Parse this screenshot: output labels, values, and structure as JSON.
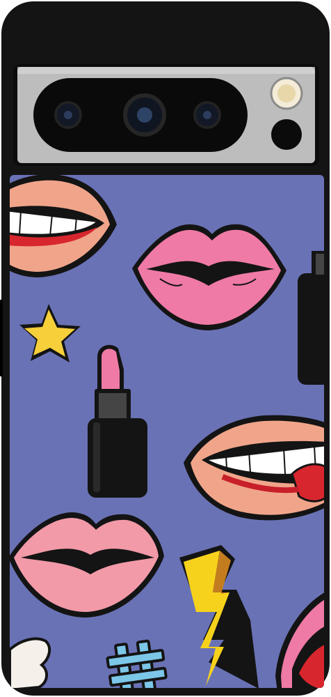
{
  "product": {
    "kind": "phone-case",
    "case_color": "#141414",
    "camera_bar_color": "#bdbdbd",
    "print_background": "#6a72b6"
  },
  "camera_bar": {
    "lenses": [
      "lens",
      "lens",
      "lens"
    ],
    "flash_icon": "flash-icon",
    "sensor_icon": "sensor-icon"
  },
  "print_pattern": {
    "motifs": [
      "lips-teeth",
      "lips-kiss",
      "star",
      "lipstick",
      "lips-teeth-tongue",
      "lips-kiss",
      "lightning-bolt",
      "hashtag",
      "lips-open",
      "lips-tongue"
    ],
    "colors": {
      "pink_lips": "#ef7aa6",
      "peach_lips": "#f0a58a",
      "outline": "#141414",
      "star": "#f6cf3a",
      "lightning": "#f7d21c",
      "hashtag": "#7cc6e8",
      "tongue": "#d8262e"
    }
  }
}
